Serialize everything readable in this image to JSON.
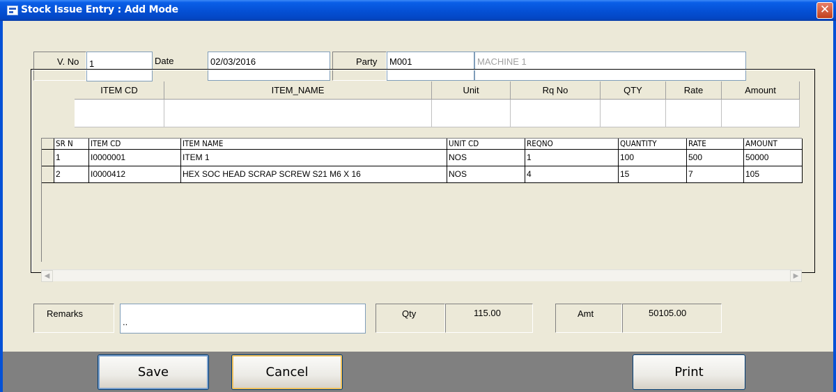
{
  "window": {
    "title": "Stock Issue Entry : Add Mode",
    "close_glyph": "✕"
  },
  "form": {
    "vno_label": "V. No",
    "vno_value": "1",
    "date_label": "Date",
    "date_value": "02/03/2016",
    "party_label": "Party",
    "party_code": "M001",
    "party_name": "MACHINE 1"
  },
  "entry_header": {
    "columns": [
      "ITEM CD",
      "ITEM_NAME",
      "Unit",
      "Rq No",
      "QTY",
      "Rate",
      "Amount"
    ]
  },
  "grid": {
    "columns": [
      "SR N",
      "ITEM CD",
      "ITEM NAME",
      "UNIT CD",
      "REQNO",
      "QUANTITY",
      "RATE",
      "AMOUNT"
    ],
    "rows": [
      [
        "1",
        "I0000001",
        "ITEM 1",
        "NOS",
        "1",
        "100",
        "500",
        "50000"
      ],
      [
        "2",
        "I0000412",
        "HEX SOC HEAD SCRAP SCREW S21 M6 X 16",
        "NOS",
        "4",
        "15",
        "7",
        "105"
      ]
    ]
  },
  "footer": {
    "remarks_label": "Remarks",
    "remarks_value": "..",
    "qty_label": "Qty",
    "qty_value": "115.00",
    "amt_label": "Amt",
    "amt_value": "50105.00"
  },
  "buttons": {
    "save": "Save",
    "cancel": "Cancel",
    "print": "Print"
  },
  "colors": {
    "titlebar": "#0551D6",
    "form_bg": "#ECE9D8",
    "bottom_bar": "#808080",
    "close_button": "#C2401C"
  }
}
